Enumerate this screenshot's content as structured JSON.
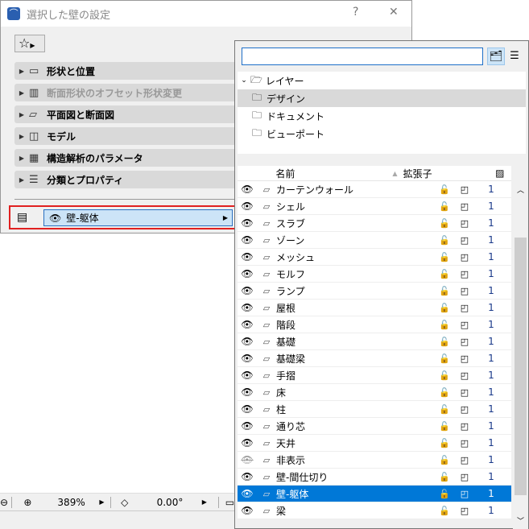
{
  "dialog": {
    "title": "選択した壁の設定",
    "help": "?",
    "close": "✕",
    "panels": [
      {
        "label": "形状と位置",
        "enabled": true
      },
      {
        "label": "断面形状のオフセット形状変更",
        "enabled": false
      },
      {
        "label": "平面図と断面図",
        "enabled": true
      },
      {
        "label": "モデル",
        "enabled": true
      },
      {
        "label": "構造解析のパラメータ",
        "enabled": true
      },
      {
        "label": "分類とプロパティ",
        "enabled": true
      }
    ],
    "layer_value": "壁-躯体"
  },
  "status": {
    "zoom": "389%",
    "angle": "0.00°"
  },
  "popup": {
    "search_value": "",
    "tree": {
      "root": "レイヤー",
      "children": [
        "デザイン",
        "ドキュメント",
        "ビューポート"
      ],
      "selected": "デザイン"
    },
    "headers": {
      "name": "名前",
      "ext": "拡張子"
    },
    "rows": [
      {
        "name": "カーテンウォール",
        "visible": true,
        "pen": "1"
      },
      {
        "name": "シェル",
        "visible": true,
        "pen": "1"
      },
      {
        "name": "スラブ",
        "visible": true,
        "pen": "1"
      },
      {
        "name": "ゾーン",
        "visible": true,
        "pen": "1"
      },
      {
        "name": "メッシュ",
        "visible": true,
        "pen": "1"
      },
      {
        "name": "モルフ",
        "visible": true,
        "pen": "1"
      },
      {
        "name": "ランプ",
        "visible": true,
        "pen": "1"
      },
      {
        "name": "屋根",
        "visible": true,
        "pen": "1"
      },
      {
        "name": "階段",
        "visible": true,
        "pen": "1"
      },
      {
        "name": "基礎",
        "visible": true,
        "pen": "1"
      },
      {
        "name": "基礎梁",
        "visible": true,
        "pen": "1"
      },
      {
        "name": "手摺",
        "visible": true,
        "pen": "1"
      },
      {
        "name": "床",
        "visible": true,
        "pen": "1"
      },
      {
        "name": "柱",
        "visible": true,
        "pen": "1"
      },
      {
        "name": "通り芯",
        "visible": true,
        "pen": "1"
      },
      {
        "name": "天井",
        "visible": true,
        "pen": "1"
      },
      {
        "name": "非表示",
        "visible": false,
        "pen": "1"
      },
      {
        "name": "壁-間仕切り",
        "visible": true,
        "pen": "1"
      },
      {
        "name": "壁-躯体",
        "visible": true,
        "pen": "1",
        "selected": true
      },
      {
        "name": "梁",
        "visible": true,
        "pen": "1"
      }
    ]
  }
}
